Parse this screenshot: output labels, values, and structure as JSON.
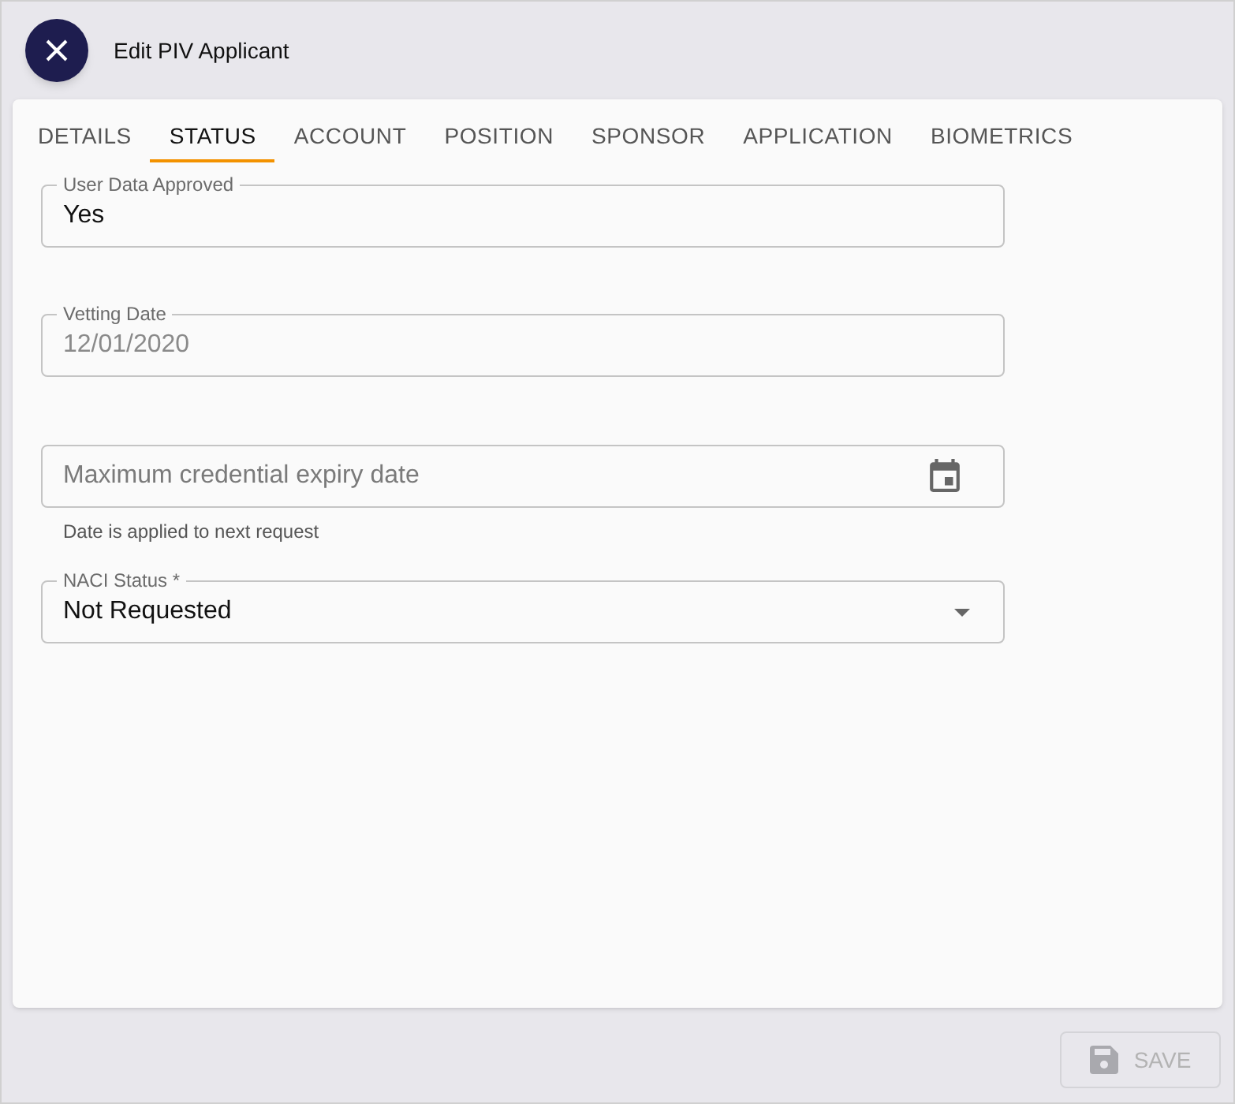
{
  "header": {
    "title": "Edit PIV Applicant"
  },
  "tabs": [
    {
      "label": "DETAILS",
      "selected": false
    },
    {
      "label": "STATUS",
      "selected": true
    },
    {
      "label": "ACCOUNT",
      "selected": false
    },
    {
      "label": "POSITION",
      "selected": false
    },
    {
      "label": "SPONSOR",
      "selected": false
    },
    {
      "label": "APPLICATION",
      "selected": false
    },
    {
      "label": "BIOMETRICS",
      "selected": false
    }
  ],
  "fields": [
    {
      "kind": "text",
      "label": "User Data Approved",
      "value": "Yes",
      "disabled": false
    },
    {
      "kind": "text",
      "label": "Vetting Date",
      "value": "12/01/2020",
      "disabled": true
    },
    {
      "kind": "date",
      "placeholder": "Maximum credential expiry date",
      "helper": "Date is applied to next request"
    },
    {
      "kind": "select",
      "label": "NACI Status *",
      "value": "Not Requested"
    }
  ],
  "save_button": {
    "label": "SAVE",
    "disabled": true
  }
}
